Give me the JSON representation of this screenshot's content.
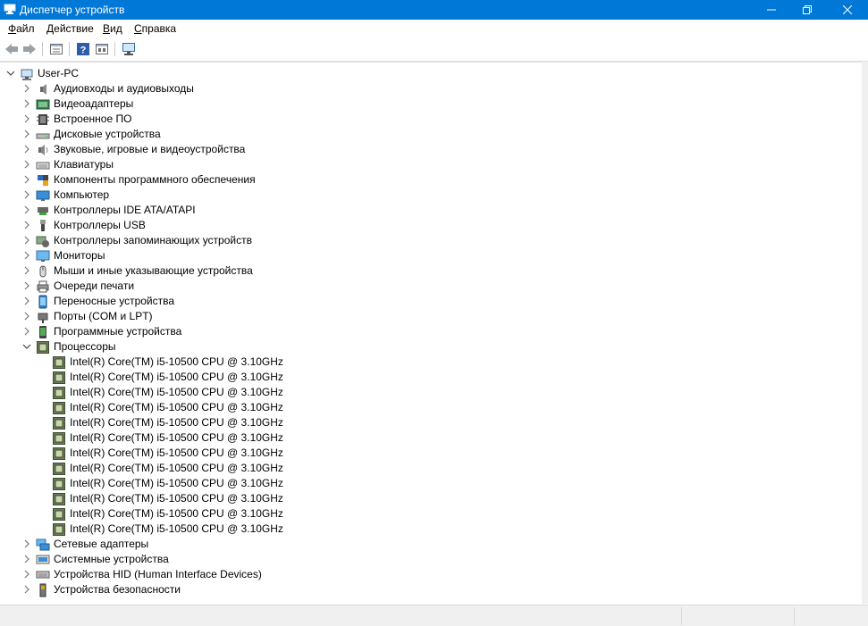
{
  "window": {
    "title": "Диспетчер устройств",
    "accent": "#0078d7"
  },
  "menu": [
    {
      "label": "Файл",
      "underline": "Ф"
    },
    {
      "label": "Действие",
      "underline": "Д"
    },
    {
      "label": "Вид",
      "underline": "В"
    },
    {
      "label": "Справка",
      "underline": "С"
    }
  ],
  "toolbar": [
    "back-icon",
    "forward-icon",
    "properties-view-icon",
    "help-icon",
    "update-driver-icon",
    "scan-hardware-icon"
  ],
  "root": {
    "label": "User-PC",
    "icon": "computer-root-icon",
    "expanded": true
  },
  "categories_before": [
    {
      "label": "Аудиовходы и аудиовыходы",
      "icon": "audio-io-icon"
    },
    {
      "label": "Видеоадаптеры",
      "icon": "display-adapter-icon"
    },
    {
      "label": "Встроенное ПО",
      "icon": "firmware-icon"
    },
    {
      "label": "Дисковые устройства",
      "icon": "disk-drive-icon"
    },
    {
      "label": "Звуковые, игровые и видеоустройства",
      "icon": "sound-icon"
    },
    {
      "label": "Клавиатуры",
      "icon": "keyboard-icon"
    },
    {
      "label": "Компоненты программного обеспечения",
      "icon": "software-component-icon"
    },
    {
      "label": "Компьютер",
      "icon": "computer-icon"
    },
    {
      "label": "Контроллеры IDE ATA/ATAPI",
      "icon": "ide-controller-icon"
    },
    {
      "label": "Контроллеры USB",
      "icon": "usb-icon"
    },
    {
      "label": "Контроллеры запоминающих устройств",
      "icon": "storage-controller-icon"
    },
    {
      "label": "Мониторы",
      "icon": "monitor-icon"
    },
    {
      "label": "Мыши и иные указывающие устройства",
      "icon": "mouse-icon"
    },
    {
      "label": "Очереди печати",
      "icon": "printer-icon"
    },
    {
      "label": "Переносные устройства",
      "icon": "portable-device-icon"
    },
    {
      "label": "Порты (COM и LPT)",
      "icon": "port-icon"
    },
    {
      "label": "Программные устройства",
      "icon": "software-device-icon"
    }
  ],
  "processors": {
    "label": "Процессоры",
    "icon": "processor-icon",
    "expanded": true,
    "items": [
      "Intel(R) Core(TM) i5-10500 CPU @ 3.10GHz",
      "Intel(R) Core(TM) i5-10500 CPU @ 3.10GHz",
      "Intel(R) Core(TM) i5-10500 CPU @ 3.10GHz",
      "Intel(R) Core(TM) i5-10500 CPU @ 3.10GHz",
      "Intel(R) Core(TM) i5-10500 CPU @ 3.10GHz",
      "Intel(R) Core(TM) i5-10500 CPU @ 3.10GHz",
      "Intel(R) Core(TM) i5-10500 CPU @ 3.10GHz",
      "Intel(R) Core(TM) i5-10500 CPU @ 3.10GHz",
      "Intel(R) Core(TM) i5-10500 CPU @ 3.10GHz",
      "Intel(R) Core(TM) i5-10500 CPU @ 3.10GHz",
      "Intel(R) Core(TM) i5-10500 CPU @ 3.10GHz",
      "Intel(R) Core(TM) i5-10500 CPU @ 3.10GHz"
    ]
  },
  "categories_after": [
    {
      "label": "Сетевые адаптеры",
      "icon": "network-adapter-icon"
    },
    {
      "label": "Системные устройства",
      "icon": "system-device-icon"
    },
    {
      "label": "Устройства HID (Human Interface Devices)",
      "icon": "hid-icon"
    },
    {
      "label": "Устройства безопасности",
      "icon": "security-device-icon"
    }
  ]
}
